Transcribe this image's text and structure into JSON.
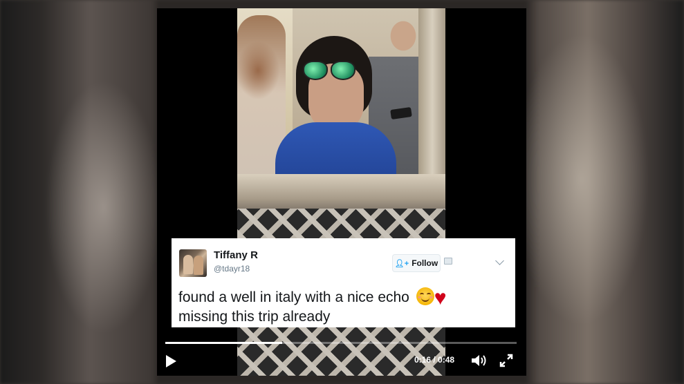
{
  "tweet": {
    "name": "Tiffany R",
    "handle": "@tdayr18",
    "follow_label": "Follow",
    "text_line1": "found a well in italy with a nice echo",
    "text_line2": "missing this trip already",
    "emojis": [
      "smiling-face-with-blush-emoji",
      "red-heart-emoji"
    ]
  },
  "player": {
    "time_display": "0:16 / 0:48",
    "progress_fraction": 0.333,
    "icons": [
      "play-icon",
      "volume-icon",
      "fullscreen-icon"
    ]
  },
  "colors": {
    "follow_icon": "#1da1f2",
    "heart": "#d0021b",
    "name": "#14171a",
    "handle": "#657786"
  }
}
